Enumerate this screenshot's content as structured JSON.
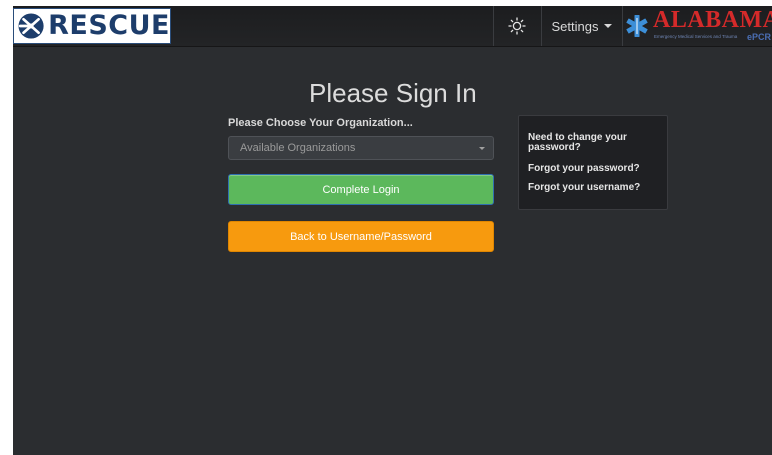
{
  "navbar": {
    "brand_name": "RESCUE",
    "theme_icon": "sun-icon",
    "settings_label": "Settings",
    "partner_logo": {
      "name": "ALABAMA",
      "subtitle": "Emergency Medical Services and Trauma",
      "tag": "ePCR"
    }
  },
  "signin": {
    "title": "Please Sign In",
    "org_label": "Please Choose Your Organization...",
    "org_select_value": "Available Organizations",
    "complete_login_label": "Complete Login",
    "back_label": "Back to Username/Password"
  },
  "help": {
    "change_password": "Need to change your password?",
    "forgot_password": "Forgot your password?",
    "forgot_username": "Forgot your username?"
  },
  "colors": {
    "background": "#2b2d30",
    "navbar": "#1f2022",
    "primary_button": "#5cb85c",
    "secondary_button": "#f79a0e",
    "brand_blue": "#1d3d6b",
    "partner_red": "#d42a2a"
  }
}
